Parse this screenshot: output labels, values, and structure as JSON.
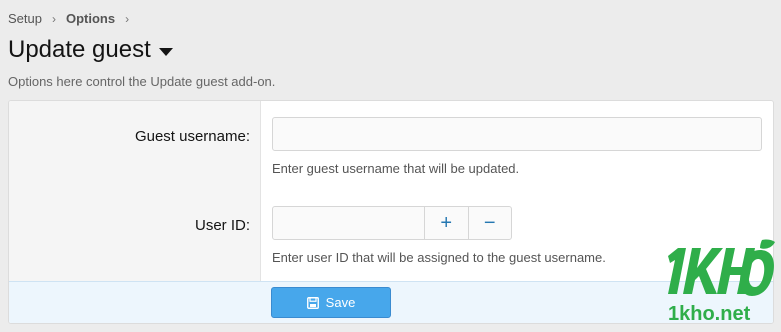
{
  "breadcrumb": {
    "items": [
      "Setup",
      "Options"
    ],
    "separator": "›"
  },
  "header": {
    "title": "Update guest",
    "description": "Options here control the Update guest add-on."
  },
  "form": {
    "guest_username": {
      "label": "Guest username:",
      "value": "",
      "hint": "Enter guest username that will be updated."
    },
    "user_id": {
      "label": "User ID:",
      "value": "",
      "increment_label": "+",
      "decrement_label": "−",
      "hint": "Enter user ID that will be assigned to the guest username."
    },
    "save_label": "Save"
  },
  "watermark": {
    "brand": "1KHO",
    "domain": "1kho.net",
    "color": "#2fae4a"
  },
  "colors": {
    "accent": "#47a7eb",
    "link": "#2577b1",
    "footer_bg": "#edf6fd"
  }
}
